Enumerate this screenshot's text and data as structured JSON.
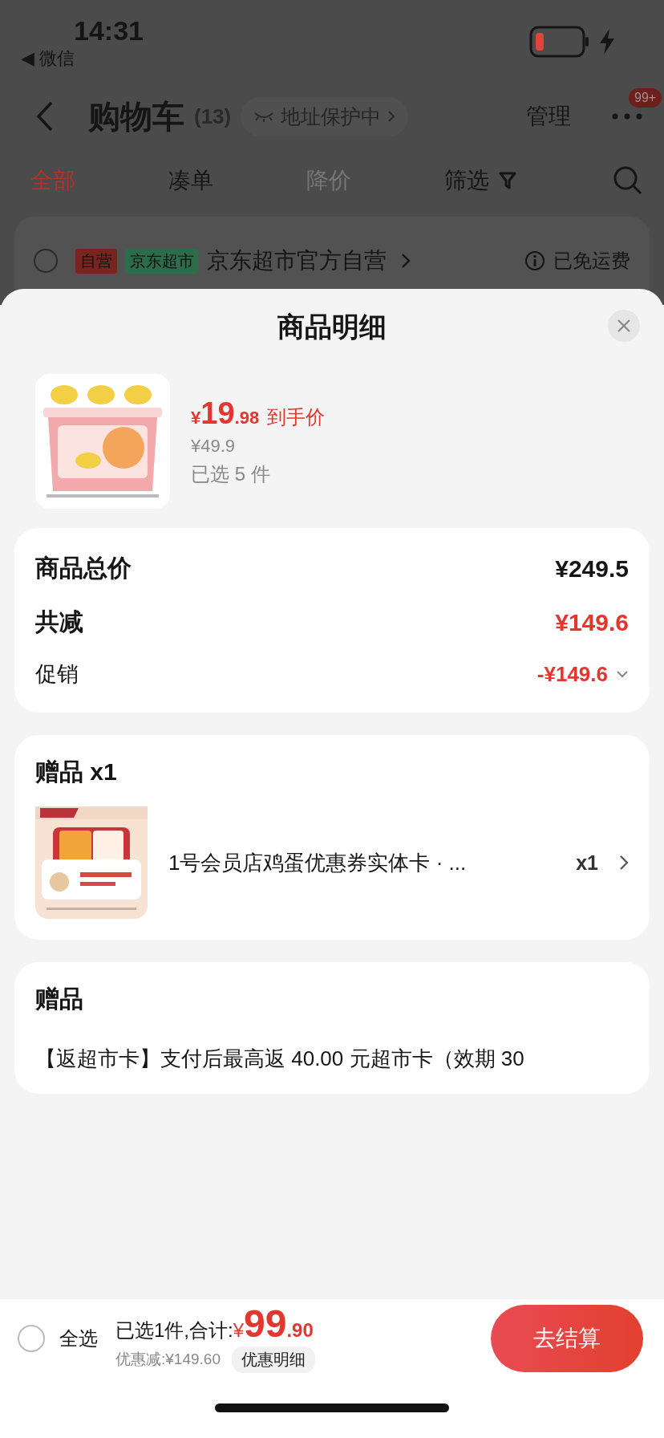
{
  "status_bar": {
    "time": "14:31",
    "back_app": "◀ 微信"
  },
  "nav": {
    "title": "购物车",
    "count": "(13)",
    "privacy": "地址保护中",
    "manage": "管理",
    "badge": "99+"
  },
  "tabs": [
    {
      "label": "全部",
      "selected": true,
      "disabled": false
    },
    {
      "label": "凑单",
      "selected": false,
      "disabled": false
    },
    {
      "label": "降价",
      "selected": false,
      "disabled": true
    }
  ],
  "filter": {
    "label": "筛选"
  },
  "store": {
    "checked": false,
    "tags": [
      {
        "label": "自营",
        "color": "#7a2420"
      },
      {
        "label": "京东超市",
        "color": "#2d6b4a"
      }
    ],
    "name": "京东超市官方自营",
    "shipping": "已免运费"
  },
  "sheet": {
    "title": "商品明细",
    "product": {
      "currency": "¥",
      "integer": "19",
      "decimal": ".98",
      "price_label": "到手价",
      "original_price": "¥49.9",
      "quantity": "已选 5 件"
    },
    "summary": [
      {
        "kind": "total",
        "label": "商品总价",
        "value": "¥249.5"
      },
      {
        "kind": "discount",
        "label": "共减",
        "value": "¥149.6"
      },
      {
        "kind": "promo",
        "label": "促销",
        "value": "-¥149.6"
      }
    ],
    "gift": {
      "title": "赠品 x1",
      "name": "1号会员店鸡蛋优惠券实体卡 · ...",
      "quantity": "x1"
    },
    "gift_note": {
      "title": "赠品",
      "text": "【返超市卡】支付后最高返 40.00 元超市卡（效期 30"
    }
  },
  "bottom_bar": {
    "select_all_checked": false,
    "select_all": "全选",
    "selected_total": "已选1件,合计:",
    "currency": "¥",
    "integer": "99",
    "decimal": ".90",
    "saving": "优惠减:¥149.60",
    "details": "优惠明细",
    "checkout": "去结算"
  }
}
